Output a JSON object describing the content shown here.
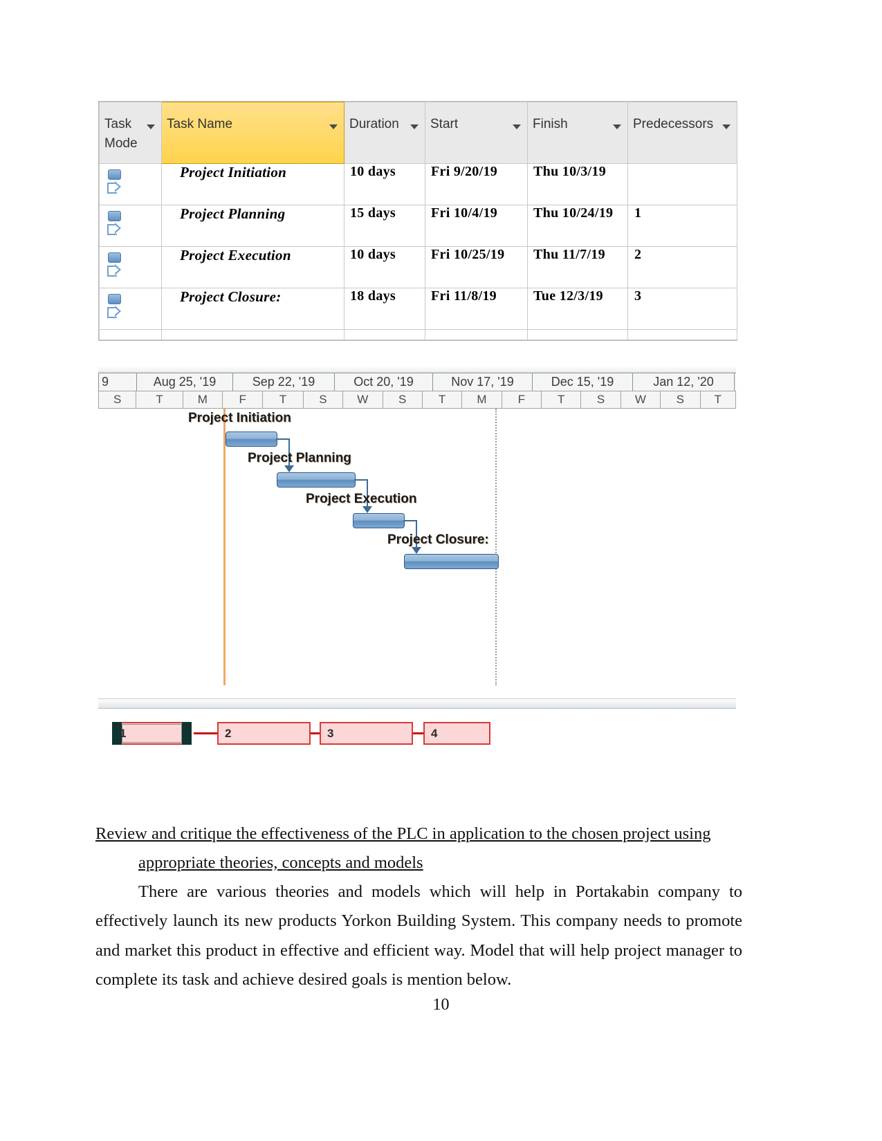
{
  "project_table": {
    "columns": [
      {
        "label": "Task Mode",
        "filter_icon": "filter-dropdown-icon"
      },
      {
        "label": "Task Name",
        "filter_icon": "filter-dropdown-icon"
      },
      {
        "label": "Duration",
        "filter_icon": "filter-dropdown-icon"
      },
      {
        "label": "Start",
        "filter_icon": "filter-dropdown-icon"
      },
      {
        "label": "Finish",
        "filter_icon": "filter-dropdown-icon"
      },
      {
        "label": "Predecessors",
        "filter_icon": "filter-dropdown-icon"
      }
    ],
    "highlight_color": "#ffd34d",
    "rows": [
      {
        "mode_icon": "manually-scheduled-icon",
        "name": "Project Initiation",
        "duration": "10 days",
        "start": "Fri 9/20/19",
        "finish": "Thu 10/3/19",
        "predecessors": ""
      },
      {
        "mode_icon": "manually-scheduled-icon",
        "name": "Project Planning",
        "duration": "15 days",
        "start": "Fri 10/4/19",
        "finish": "Thu 10/24/19",
        "predecessors": "1"
      },
      {
        "mode_icon": "manually-scheduled-icon",
        "name": "Project Execution",
        "duration": "10 days",
        "start": "Fri 10/25/19",
        "finish": "Thu 11/7/19",
        "predecessors": "2"
      },
      {
        "mode_icon": "manually-scheduled-icon",
        "name": "Project Closure:",
        "duration": "18 days",
        "start": "Fri 11/8/19",
        "finish": "Tue 12/3/19",
        "predecessors": "3"
      }
    ]
  },
  "gantt": {
    "timescale_months": [
      "9",
      "Aug 25, '19",
      "Sep 22, '19",
      "Oct 20, '19",
      "Nov 17, '19",
      "Dec 15, '19",
      "Jan 12, '20"
    ],
    "timescale_days": [
      "S",
      "T",
      "M",
      "F",
      "T",
      "S",
      "W",
      "S",
      "T",
      "M",
      "F",
      "T",
      "S",
      "W",
      "S",
      "T"
    ],
    "bar_color": "#5e8fc0",
    "today_line_color": "#f0a860",
    "tasks": [
      {
        "label": "Project Initiation",
        "left_pct": 20.0,
        "width_pct": 8.1,
        "row": 0
      },
      {
        "label": "Project Planning",
        "left_pct": 28.1,
        "width_pct": 11.9,
        "row": 1
      },
      {
        "label": "Project Execution",
        "left_pct": 40.0,
        "width_pct": 8.1,
        "row": 2
      },
      {
        "label": "Project Closure:",
        "left_pct": 48.1,
        "width_pct": 14.8,
        "row": 3
      }
    ]
  },
  "network_diagram": {
    "node_fill": "#fbd7d7",
    "node_border": "#d63a3a",
    "arrow_color": "#cc1111",
    "nodes": [
      {
        "number": "1",
        "selected": true
      },
      {
        "number": "2",
        "selected": false
      },
      {
        "number": "3",
        "selected": false
      },
      {
        "number": "4",
        "selected": false
      }
    ]
  },
  "document": {
    "heading_line1": "Review and critique the effectiveness of the PLC in application to the chosen project using",
    "heading_line2": "appropriate theories, concepts and models",
    "paragraph": "There are various theories and models which will help in Portakabin company to effectively launch its new products Yorkon Building System. This company needs to promote and market this product in effective and efficient way. Model that will help project manager to complete its task and achieve desired goals is mention below.",
    "page_number": "10"
  }
}
